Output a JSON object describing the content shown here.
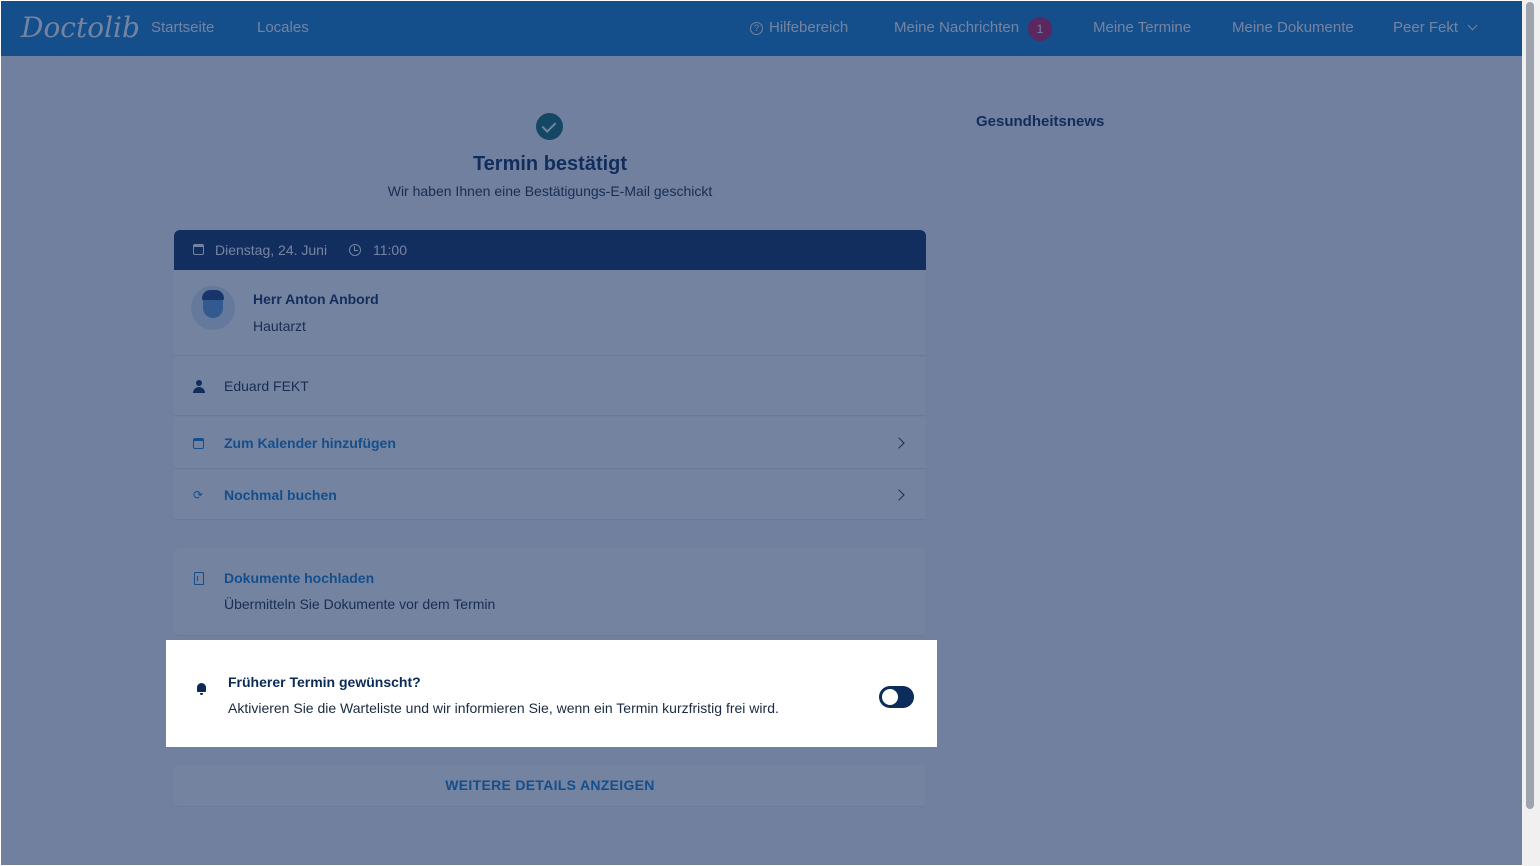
{
  "header": {
    "logo": "Doctolib",
    "nav_left": [
      "Startseite",
      "Locales"
    ],
    "help": "Hilfebereich",
    "messages": "Meine Nachrichten",
    "messages_count": "1",
    "appointments": "Meine Termine",
    "documents": "Meine Dokumente",
    "user": "Peer Fekt"
  },
  "confirmation": {
    "title": "Termin bestätigt",
    "subtitle": "Wir haben Ihnen eine Bestätigungs-E-Mail geschickt"
  },
  "appointment": {
    "date": "Dienstag, 24. Juni",
    "time": "11:00",
    "doctor_name": "Herr Anton Anbord",
    "specialty": "Hautarzt",
    "patient": "Eduard FEKT",
    "add_calendar": "Zum Kalender hinzufügen",
    "book_again": "Nochmal buchen"
  },
  "documents": {
    "title": "Dokumente hochladen",
    "description": "Übermitteln Sie Dokumente vor dem Termin"
  },
  "waitlist": {
    "title": "Früherer Termin gewünscht?",
    "description": "Aktivieren Sie die Warteliste und wir informieren Sie, wenn ein Termin kurzfristig frei wird.",
    "enabled": false
  },
  "more_details": "WEITERE DETAILS ANZEIGEN",
  "sidebar": {
    "news_title": "Gesundheitsnews"
  },
  "colors": {
    "brand": "#107aca",
    "dark_navy": "#0c2c5c",
    "overlay": "rgba(24,48,96,0.60)",
    "badge": "#c2185b"
  }
}
